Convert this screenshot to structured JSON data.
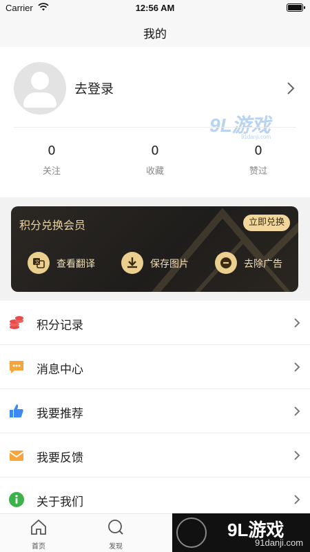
{
  "status_bar": {
    "carrier": "Carrier",
    "time": "12:56 AM"
  },
  "nav": {
    "title": "我的"
  },
  "profile": {
    "login_label": "去登录"
  },
  "stats": [
    {
      "value": "0",
      "label": "关注"
    },
    {
      "value": "0",
      "label": "收藏"
    },
    {
      "value": "0",
      "label": "赞过"
    }
  ],
  "vip": {
    "title": "积分兑换会员",
    "button": "立即兑换",
    "features": [
      {
        "icon": "translate-icon",
        "label": "查看翻译"
      },
      {
        "icon": "download-icon",
        "label": "保存图片"
      },
      {
        "icon": "minus-circle-icon",
        "label": "去除广告"
      }
    ]
  },
  "menu": [
    {
      "icon": "coins-icon",
      "label": "积分记录"
    },
    {
      "icon": "message-icon",
      "label": "消息中心"
    },
    {
      "icon": "thumbs-up-icon",
      "label": "我要推荐"
    },
    {
      "icon": "feedback-mail-icon",
      "label": "我要反馈"
    },
    {
      "icon": "info-icon",
      "label": "关于我们"
    }
  ],
  "tabs": [
    {
      "icon": "home-icon",
      "label": "首页"
    },
    {
      "icon": "discover-icon",
      "label": "发现"
    }
  ],
  "watermark": {
    "brand": "9L游戏",
    "sub": "91danji.com"
  },
  "colors": {
    "gold": "#ebcf8e",
    "card_bg": "#1f1d1b",
    "red": "#e84a4a",
    "orange": "#f5a53b",
    "blue": "#3d8bf2",
    "green": "#3cb34a"
  }
}
